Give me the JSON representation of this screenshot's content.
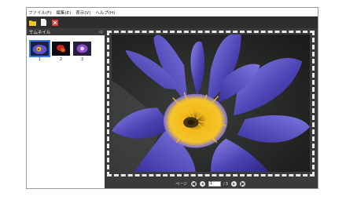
{
  "menu": [
    "ファイル(F)",
    "編集(E)",
    "表示(V)",
    "ヘルプ(H)"
  ],
  "toolbar": {
    "icons": [
      "folder-icon",
      "document-icon",
      "delete-icon"
    ],
    "colors": {
      "folder": "#f5c518",
      "document": "#f4f4f4",
      "delete": "#e53b2f"
    }
  },
  "thumbnail_panel": {
    "title": "サムネイル",
    "collapse_glyph": "◁",
    "items": [
      {
        "number": "1",
        "selected": true
      },
      {
        "number": "2",
        "selected": false
      },
      {
        "number": "3",
        "selected": false
      }
    ]
  },
  "pager": {
    "label": "ページ",
    "current": "1",
    "separator": "/",
    "total": "3"
  },
  "colors": {
    "selection": "#3a7be6",
    "panel_dark": "#3a3a3a"
  }
}
